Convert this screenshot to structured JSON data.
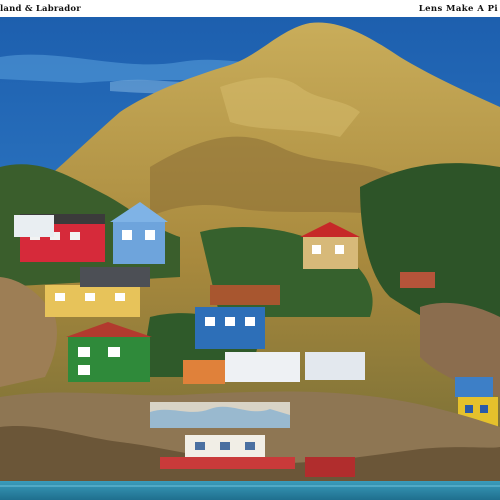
{
  "header": {
    "left_caption": "land & Labrador",
    "right_caption": "Lens Make A Pi"
  },
  "photo": {
    "subject": "hillside village with colorful wooden houses beneath a rocky hill by the harbour",
    "colors": {
      "sky": "#1f6fc2",
      "water": "#2f8fb0",
      "hill": "#b59a4a",
      "forest": "#2e5a2a"
    }
  }
}
